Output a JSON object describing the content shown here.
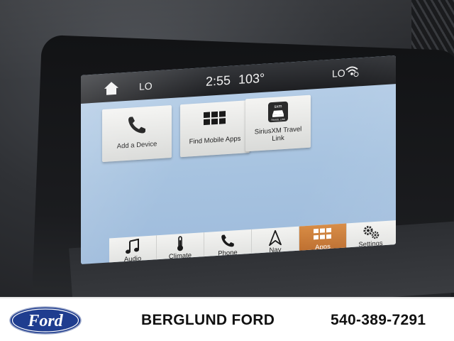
{
  "status_bar": {
    "temp_left": "LO",
    "time": "2:55",
    "outside_temp": "103°",
    "temp_right": "LO"
  },
  "app_tiles": [
    {
      "label": "Add a Device",
      "icon": "phone-handset-icon"
    },
    {
      "label": "Find Mobile Apps",
      "icon": "app-grid-icon"
    },
    {
      "label": "SiriusXM Travel Link",
      "icon": "siriusxm-travel-link-icon",
      "badge_top": "sxm",
      "badge_bottom": "TRAVEL LINK"
    }
  ],
  "dock": [
    {
      "label": "Audio",
      "icon": "music-note-icon",
      "active": false
    },
    {
      "label": "Climate",
      "icon": "thermometer-icon",
      "active": false
    },
    {
      "label": "Phone",
      "icon": "phone-icon",
      "active": false
    },
    {
      "label": "Nav",
      "icon": "navigation-arrow-icon",
      "active": false
    },
    {
      "label": "Apps",
      "icon": "apps-grid-icon",
      "active": true
    },
    {
      "label": "Settings",
      "icon": "gears-icon",
      "active": false
    }
  ],
  "footer": {
    "logo_text": "Ford",
    "dealer_name": "BERGLUND FORD",
    "phone": "540-389-7291"
  },
  "colors": {
    "active_tab": "#c97a36",
    "screen_background": "#aac5e2",
    "ford_blue": "#1f3d8f"
  }
}
